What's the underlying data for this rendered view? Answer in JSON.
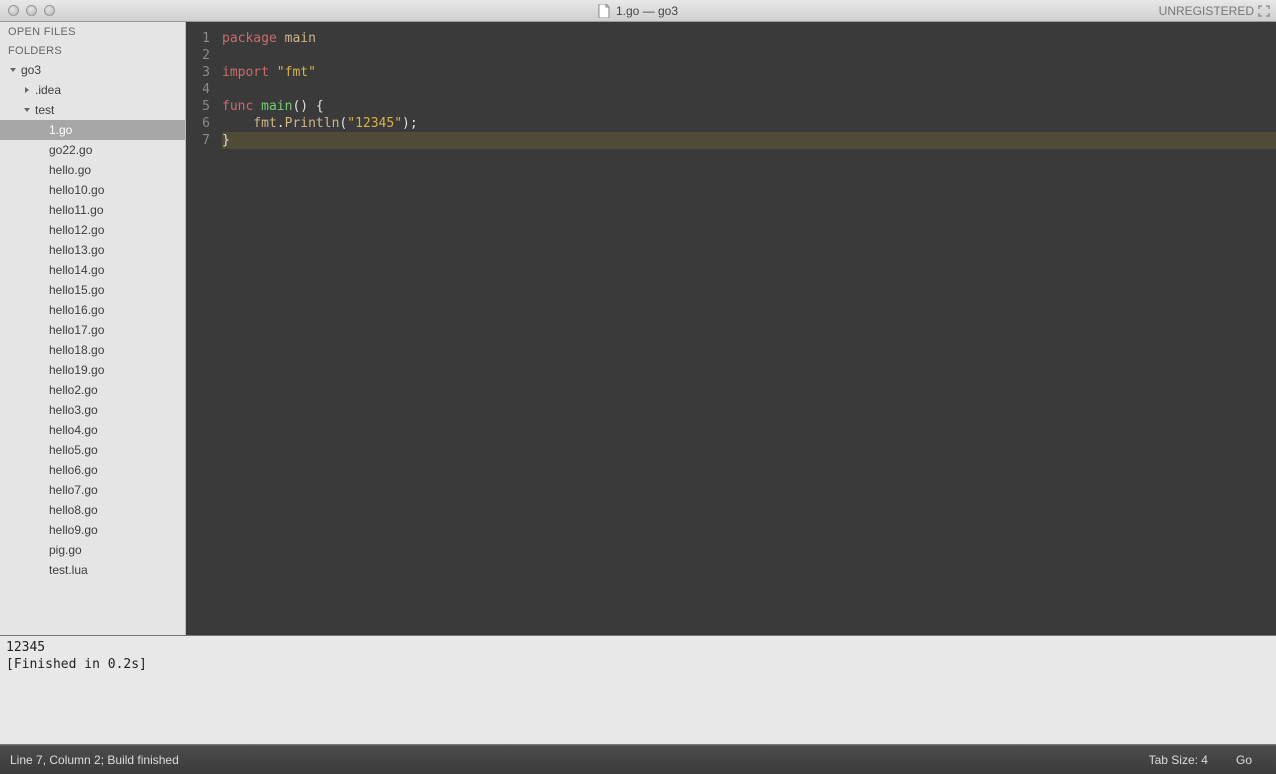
{
  "titlebar": {
    "filename": "1.go — go3",
    "unregistered": "UNREGISTERED"
  },
  "sidebar": {
    "open_files_label": "OPEN FILES",
    "folders_label": "FOLDERS",
    "root": {
      "name": "go3",
      "children": [
        {
          "name": ".idea",
          "expanded": false,
          "type": "folder"
        },
        {
          "name": "test",
          "expanded": true,
          "type": "folder",
          "children": [
            {
              "name": "1.go",
              "selected": true
            },
            {
              "name": "go22.go"
            },
            {
              "name": "hello.go"
            },
            {
              "name": "hello10.go"
            },
            {
              "name": "hello11.go"
            },
            {
              "name": "hello12.go"
            },
            {
              "name": "hello13.go"
            },
            {
              "name": "hello14.go"
            },
            {
              "name": "hello15.go"
            },
            {
              "name": "hello16.go"
            },
            {
              "name": "hello17.go"
            },
            {
              "name": "hello18.go"
            },
            {
              "name": "hello19.go"
            },
            {
              "name": "hello2.go"
            },
            {
              "name": "hello3.go"
            },
            {
              "name": "hello4.go"
            },
            {
              "name": "hello5.go"
            },
            {
              "name": "hello6.go"
            },
            {
              "name": "hello7.go"
            },
            {
              "name": "hello8.go"
            },
            {
              "name": "hello9.go"
            },
            {
              "name": "pig.go"
            },
            {
              "name": "test.lua"
            }
          ]
        }
      ]
    }
  },
  "code": {
    "lines": [
      [
        {
          "t": "package",
          "c": "kw"
        },
        {
          "t": " ",
          "c": "p"
        },
        {
          "t": "main",
          "c": "tan"
        }
      ],
      [],
      [
        {
          "t": "import",
          "c": "kw"
        },
        {
          "t": " ",
          "c": "p"
        },
        {
          "t": "\"fmt\"",
          "c": "str"
        }
      ],
      [],
      [
        {
          "t": "func",
          "c": "kw"
        },
        {
          "t": " ",
          "c": "p"
        },
        {
          "t": "main",
          "c": "func"
        },
        {
          "t": "() {",
          "c": "punc"
        }
      ],
      [
        {
          "t": "    fmt",
          "c": "tan"
        },
        {
          "t": ".",
          "c": "punc"
        },
        {
          "t": "Println",
          "c": "tan"
        },
        {
          "t": "(",
          "c": "punc"
        },
        {
          "t": "\"12345\"",
          "c": "str"
        },
        {
          "t": ");",
          "c": "punc"
        }
      ],
      [
        {
          "t": "}",
          "c": "punc"
        }
      ]
    ],
    "highlighted_line_index": 6
  },
  "console": {
    "output": "12345",
    "finished": "[Finished in 0.2s]"
  },
  "statusbar": {
    "left": "Line 7, Column 2; Build finished",
    "tab_size": "Tab Size: 4",
    "syntax": "Go"
  }
}
